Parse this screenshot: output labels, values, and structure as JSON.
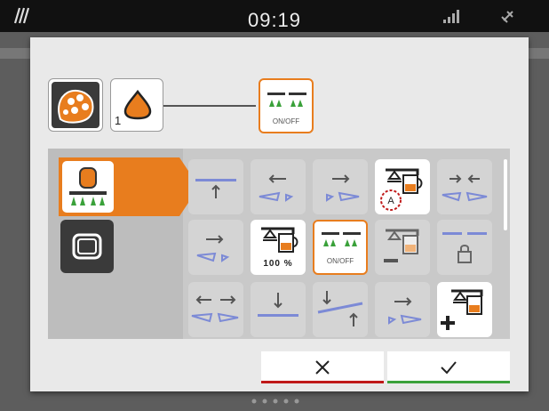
{
  "status_bar": {
    "time": "09:19"
  },
  "header": {
    "section_number": "1",
    "function_tile_label": "ON/OFF"
  },
  "categories": [
    {
      "icon": "sprayer-icon",
      "selected": true
    },
    {
      "icon": "display-frame-icon",
      "selected": false
    }
  ],
  "function_grid": [
    {
      "icon": "boom-fold-up-icon"
    },
    {
      "icon": "boom-left-fold-in-icon"
    },
    {
      "icon": "boom-right-fold-in-icon"
    },
    {
      "icon": "auto-rate-control-icon"
    },
    {
      "icon": "boom-both-fold-in-icon"
    },
    {
      "icon": "boom-right-fold-out-icon"
    },
    {
      "icon": "rate-100-percent-icon",
      "label": "100 %"
    },
    {
      "icon": "section-on-off-icon",
      "label": "ON/OFF",
      "selected": true
    },
    {
      "icon": "rate-decrease-icon"
    },
    {
      "icon": "boom-lock-icon"
    },
    {
      "icon": "boom-both-fold-out-icon"
    },
    {
      "icon": "boom-lower-icon"
    },
    {
      "icon": "boom-tilt-icon"
    },
    {
      "icon": "boom-right-fold-out-icon"
    },
    {
      "icon": "rate-increase-icon"
    }
  ],
  "buttons": {
    "cancel": "cancel-icon",
    "confirm": "confirm-icon"
  },
  "colors": {
    "accent": "#e87d1e",
    "cancel": "#c01a1a",
    "confirm": "#3aa13a",
    "nozzle_green": "#3aa13a"
  }
}
